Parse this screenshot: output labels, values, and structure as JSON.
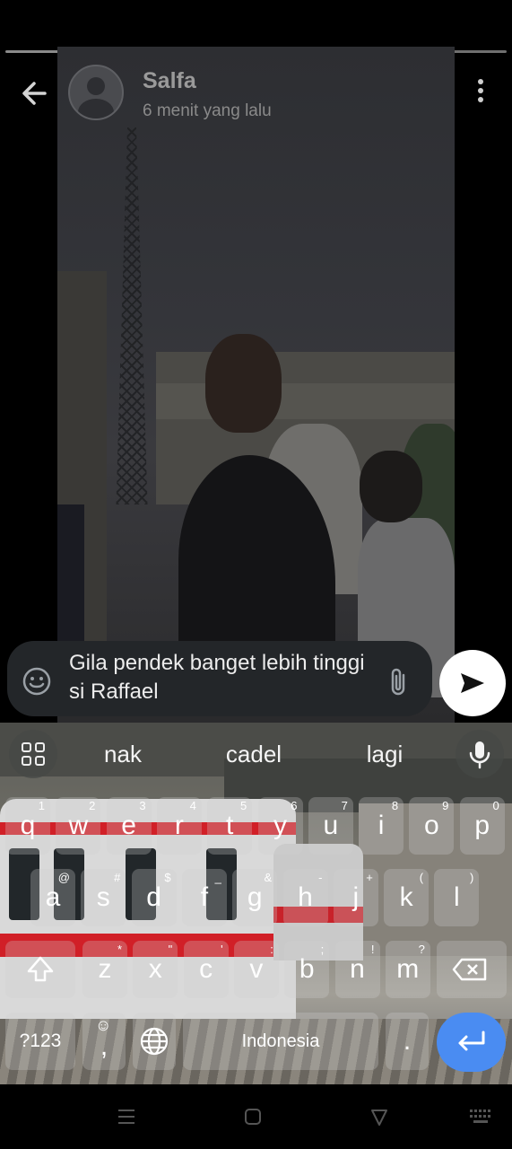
{
  "header": {
    "contact_name": "Salfa",
    "timestamp": "6 menit yang lalu"
  },
  "reply": {
    "text": "Gila pendek banget lebih tinggi si Raffael"
  },
  "keyboard": {
    "suggestions": [
      "nak",
      "cadel",
      "lagi"
    ],
    "row1": [
      {
        "key": "q",
        "hint": "1"
      },
      {
        "key": "w",
        "hint": "2"
      },
      {
        "key": "e",
        "hint": "3"
      },
      {
        "key": "r",
        "hint": "4"
      },
      {
        "key": "t",
        "hint": "5"
      },
      {
        "key": "y",
        "hint": "6"
      },
      {
        "key": "u",
        "hint": "7"
      },
      {
        "key": "i",
        "hint": "8"
      },
      {
        "key": "o",
        "hint": "9"
      },
      {
        "key": "p",
        "hint": "0"
      }
    ],
    "row2": [
      {
        "key": "a",
        "hint": "@"
      },
      {
        "key": "s",
        "hint": "#"
      },
      {
        "key": "d",
        "hint": "$"
      },
      {
        "key": "f",
        "hint": "_"
      },
      {
        "key": "g",
        "hint": "&"
      },
      {
        "key": "h",
        "hint": "-"
      },
      {
        "key": "j",
        "hint": "+"
      },
      {
        "key": "k",
        "hint": "("
      },
      {
        "key": "l",
        "hint": ")"
      }
    ],
    "row3": [
      {
        "key": "z",
        "hint": "*"
      },
      {
        "key": "x",
        "hint": "\""
      },
      {
        "key": "c",
        "hint": "'"
      },
      {
        "key": "v",
        "hint": ":"
      },
      {
        "key": "b",
        "hint": ";"
      },
      {
        "key": "n",
        "hint": "!"
      },
      {
        "key": "m",
        "hint": "?"
      }
    ],
    "symbols_label": "?123",
    "comma_label": ",",
    "space_label": "Indonesia",
    "period_label": "."
  },
  "colors": {
    "send_button": "#ffffff",
    "enter_key": "#4a8cf2"
  }
}
